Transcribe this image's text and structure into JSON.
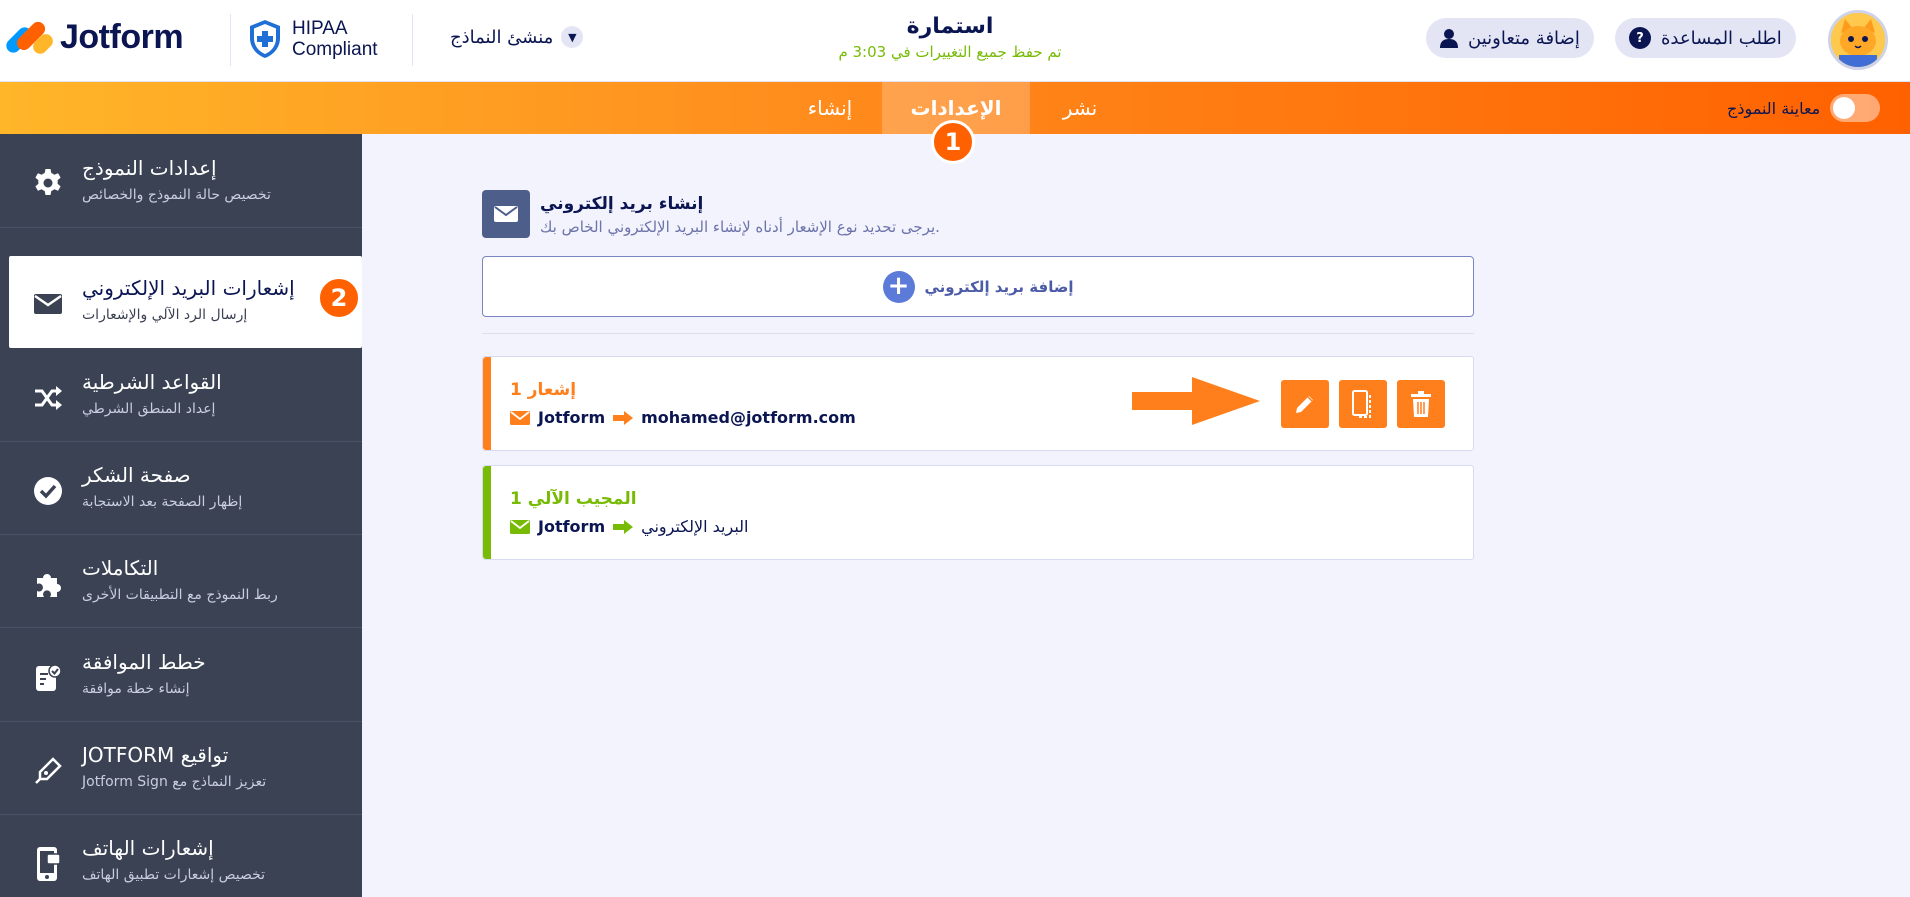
{
  "header": {
    "logo_text": "Jotform",
    "hipaa_line1": "HIPAA",
    "hipaa_line2": "Compliant",
    "form_creator": "منشئ النماذج",
    "form_title": "استمارة",
    "saved_status": "تم حفظ جميع التغييرات في 3:03 م",
    "add_collaborators": "إضافة متعاونين",
    "get_help": "اطلب المساعدة"
  },
  "nav": {
    "preview_label": "معاينة النموذج",
    "tabs": [
      {
        "label": "نشر",
        "active": false
      },
      {
        "label": "الإعدادات",
        "active": true
      },
      {
        "label": "إنشاء",
        "active": false
      }
    ],
    "step1": "1",
    "step2": "2"
  },
  "sidebar": {
    "items": [
      {
        "title": "إعدادات النموذج",
        "subtitle": "تخصيص حالة النموذج والخصائص",
        "icon": "gear-icon",
        "active": false
      },
      {
        "title": "إشعارات البريد الإلكتروني",
        "subtitle": "إرسال الرد الآلي والإشعارات",
        "icon": "envelope-icon",
        "active": true
      },
      {
        "title": "القواعد الشرطية",
        "subtitle": "إعداد المنطق الشرطي",
        "icon": "shuffle-icon",
        "active": false
      },
      {
        "title": "صفحة الشكر",
        "subtitle": "إظهار الصفحة بعد الاستجابة",
        "icon": "check-circle-icon",
        "active": false
      },
      {
        "title": "التكاملات",
        "subtitle": "ربط النموذج مع التطبيقات الأخرى",
        "icon": "puzzle-icon",
        "active": false
      },
      {
        "title": "خطط الموافقة",
        "subtitle": "إنشاء خطة موافقة",
        "icon": "approval-icon",
        "active": false
      },
      {
        "title": "تواقيع JOTFORM",
        "subtitle": "تعزيز النماذج مع Jotform Sign",
        "icon": "pen-nib-icon",
        "active": false
      },
      {
        "title": "إشعارات الهاتف",
        "subtitle": "تخصيص إشعارات تطبيق الهاتف",
        "icon": "phone-icon",
        "active": false
      }
    ]
  },
  "main": {
    "create_title": "إنشاء بريد إلكتروني",
    "create_subtitle": "يرجى تحديد نوع الإشعار أدناه لإنشاء البريد الإلكتروني الخاص بك.",
    "add_email_label": "إضافة بريد إلكتروني",
    "emails": [
      {
        "title": "إشعار 1",
        "from": "Jotform",
        "to": "mohamed@jotform.com",
        "color": "#ff7f1c"
      },
      {
        "title": "المجيب الآلي 1",
        "from": "Jotform",
        "to": "البريد الإلكتروني",
        "color": "#78bb07"
      }
    ]
  },
  "colors": {
    "accent": "#ff6100",
    "sidebar_bg": "#3a4253",
    "navy": "#0a1551",
    "autoresponder_green": "#78bb07"
  }
}
